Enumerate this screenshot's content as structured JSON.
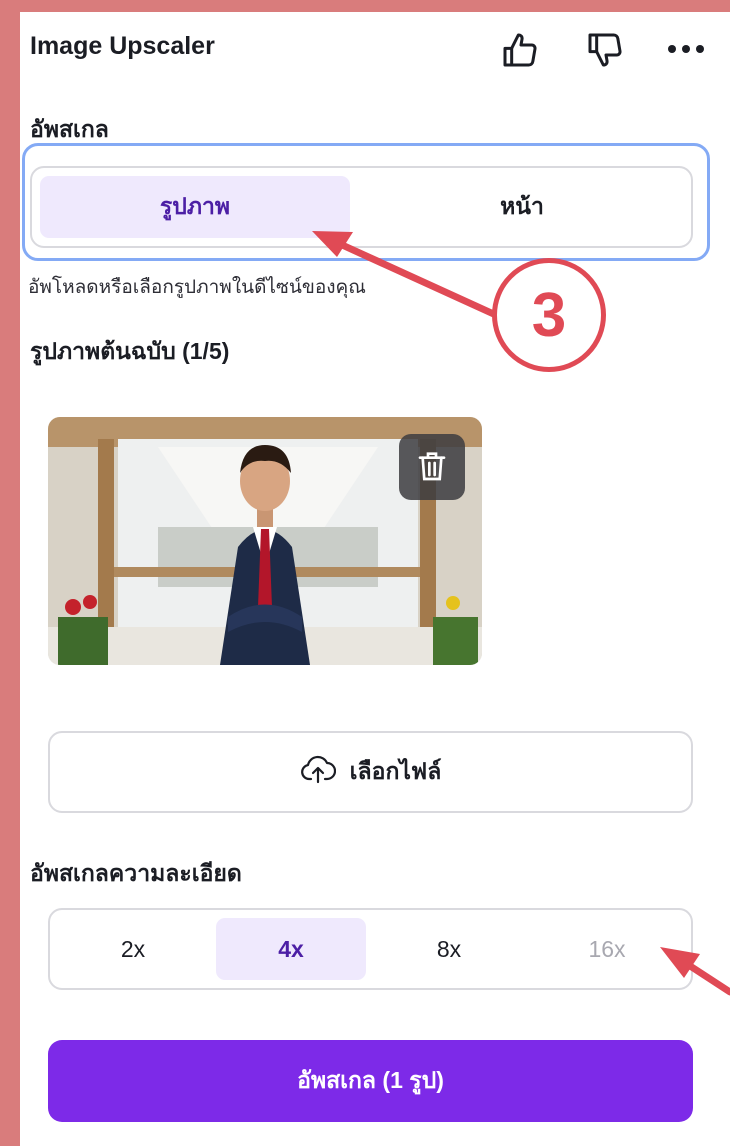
{
  "app": {
    "title": "Image Upscaler",
    "icons": [
      "thumbs-up-icon",
      "thumbs-down-icon",
      "more-options-icon"
    ]
  },
  "upscale_mode": {
    "label": "อัพสเกล",
    "options": [
      "รูปภาพ",
      "หน้า"
    ],
    "selected": "รูปภาพ",
    "hint": "อัพโหลดหรือเลือกรูปภาพในดีไซน์ของคุณ"
  },
  "original_images": {
    "label": "รูปภาพต้นฉบับ (1/5)",
    "thumbnail_icon": "delete-trash-icon"
  },
  "choose_file": {
    "label": "เลือกไฟล์",
    "icon": "cloud-upload-icon"
  },
  "resolution": {
    "label": "อัพสเกลความละเอียด",
    "options": [
      "2x",
      "4x",
      "8x",
      "16x"
    ],
    "selected": "4x",
    "disabled": [
      "16x"
    ]
  },
  "action": {
    "label": "อัพสเกล (1 รูป)"
  },
  "annotation": {
    "step_number": "3"
  },
  "colors": {
    "accent": "#7d2ae8",
    "selected_bg": "#efe9fd",
    "annotation": "#e04a55",
    "frame_bg": "#d97c7c"
  }
}
